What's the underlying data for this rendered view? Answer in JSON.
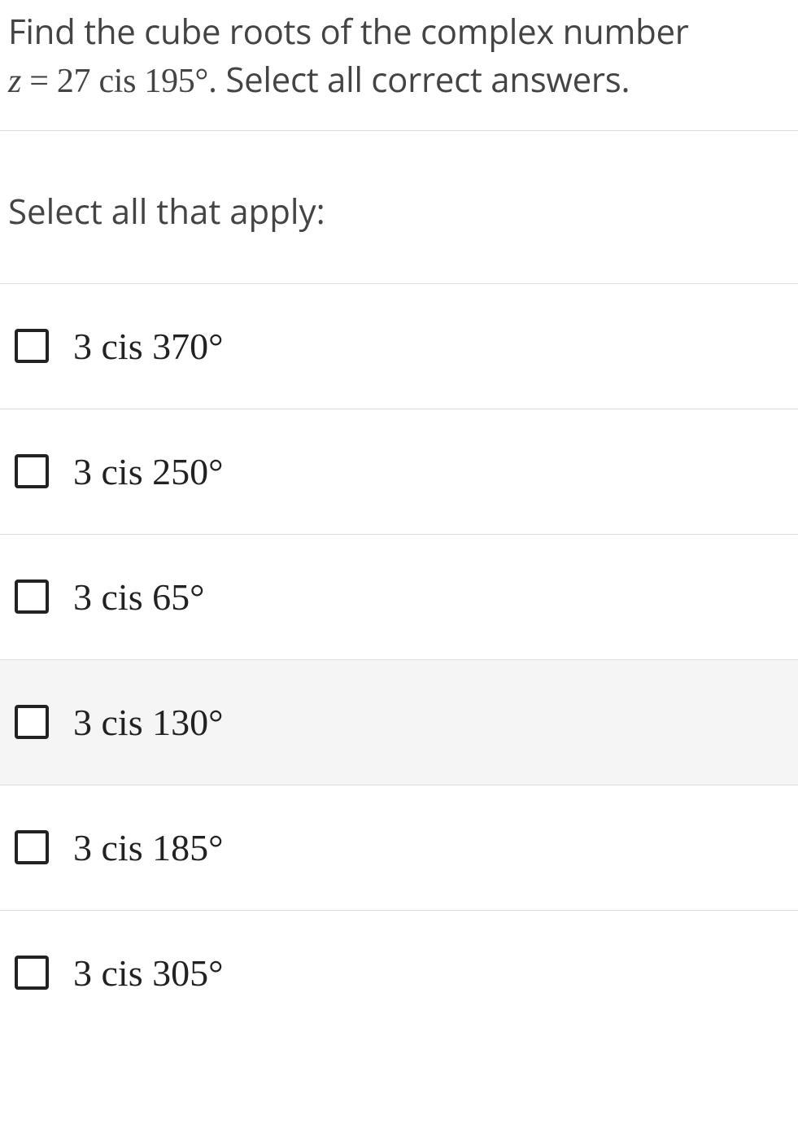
{
  "question": {
    "line1_prefix": "Find the cube roots of the complex number",
    "line2_var": "z",
    "line2_eq": " = ",
    "line2_val": "27 cis 195°",
    "line2_suffix": ". Select all correct answers."
  },
  "instruction": "Select all that apply:",
  "options": [
    {
      "label": "3 cis 370°",
      "checked": false,
      "highlighted": false
    },
    {
      "label": "3 cis 250°",
      "checked": false,
      "highlighted": false
    },
    {
      "label": "3 cis 65°",
      "checked": false,
      "highlighted": false
    },
    {
      "label": "3 cis 130°",
      "checked": false,
      "highlighted": true
    },
    {
      "label": "3 cis 185°",
      "checked": false,
      "highlighted": false
    },
    {
      "label": "3 cis 305°",
      "checked": false,
      "highlighted": false
    }
  ]
}
